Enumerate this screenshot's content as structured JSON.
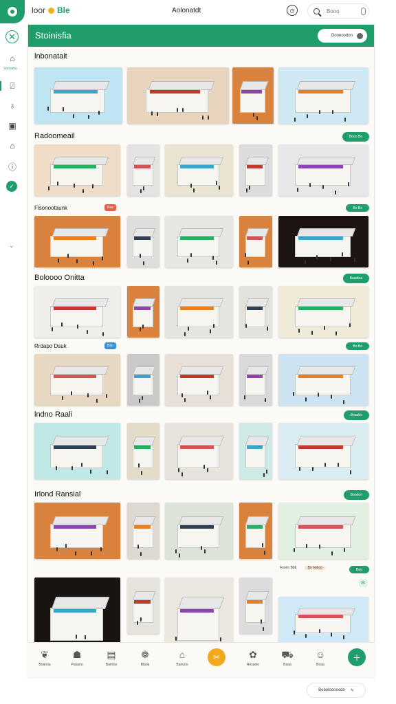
{
  "topbar": {
    "brand_prefix": "loor",
    "brand_name": "Blе",
    "title": "Aolonatdt",
    "search_placeholder": "Booo",
    "clock_icon": "clock-icon",
    "search_icon": "search-icon",
    "mic_icon": "mic-icon"
  },
  "rail": {
    "close_icon": "close-icon",
    "active_label": "Sonosho",
    "items": [
      "home-icon",
      "tag-icon",
      "bell-icon",
      "bag-icon",
      "store-icon",
      "info-icon",
      "check-icon"
    ]
  },
  "panel": {
    "title": "Stoinisfia",
    "toggle_label": "Dooeoodon"
  },
  "sections": [
    {
      "title": "lnbonatait",
      "pill": ""
    },
    {
      "title": "Radoomeail",
      "pill": "Bouo Bo"
    },
    {
      "title": "Flsonootaunk",
      "badge": "Baa",
      "badge_color": "#ec5b4a",
      "pill": "Bo Bo"
    },
    {
      "title": "Boloooo Onitta",
      "pill": "Baaidea"
    },
    {
      "title": "Rrdapo Dsuk",
      "badge": "Bao",
      "badge_color": "#3b8fd9",
      "pill": "Bo Bo"
    },
    {
      "title": "lndno Raali",
      "pill": "Beaobo"
    },
    {
      "title": "Irlond Ransial",
      "pill": "Boodon"
    },
    {
      "title": "",
      "pill": "Beo"
    }
  ],
  "promo": {
    "left_text": "Foonn Bbb",
    "mid_text": "Bo 6oboo"
  },
  "bottomnav": {
    "items": [
      {
        "icon": "leaf-icon",
        "label": "Boanoa"
      },
      {
        "icon": "person-icon",
        "label": "Pasano"
      },
      {
        "icon": "document-icon",
        "label": "Bamlss"
      },
      {
        "icon": "gift-icon",
        "label": "Blaoa"
      },
      {
        "icon": "house-icon",
        "label": "Banuoo"
      },
      {
        "icon": "settings-icon",
        "label": "Rosaolo"
      },
      {
        "icon": "truck-icon",
        "label": "Baaa"
      },
      {
        "icon": "chat-icon",
        "label": "Boaa"
      }
    ],
    "fab_icon": "tools-icon",
    "add_icon": "plus-icon"
  },
  "floating_chip": {
    "label": "Bobolooooodo",
    "icon": "wrench-icon"
  },
  "colors": {
    "accent": "#1f9e6c",
    "orange": "#f2a91c",
    "red_badge": "#ec5b4a",
    "blue_badge": "#3b8fd9"
  }
}
